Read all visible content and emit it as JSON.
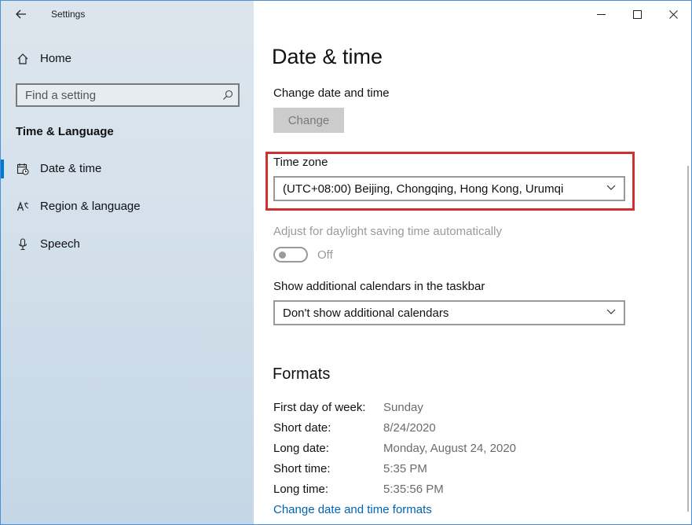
{
  "window": {
    "app_title": "Settings"
  },
  "sidebar": {
    "home_label": "Home",
    "search_placeholder": "Find a setting",
    "section_heading": "Time & Language",
    "items": [
      {
        "label": "Date & time",
        "icon": "calendar-clock-icon",
        "selected": true
      },
      {
        "label": "Region & language",
        "icon": "region-language-icon",
        "selected": false
      },
      {
        "label": "Speech",
        "icon": "microphone-icon",
        "selected": false
      }
    ]
  },
  "main": {
    "page_title": "Date & time",
    "change_date_label": "Change date and time",
    "change_button": "Change",
    "time_zone_label": "Time zone",
    "time_zone_value": "(UTC+08:00) Beijing, Chongqing, Hong Kong, Urumqi",
    "dst_label": "Adjust for daylight saving time automatically",
    "dst_state": "Off",
    "calendars_label": "Show additional calendars in the taskbar",
    "calendars_value": "Don't show additional calendars",
    "formats_title": "Formats",
    "formats": [
      {
        "key": "First day of week:",
        "value": "Sunday"
      },
      {
        "key": "Short date:",
        "value": "8/24/2020"
      },
      {
        "key": "Long date:",
        "value": "Monday, August 24, 2020"
      },
      {
        "key": "Short time:",
        "value": "5:35 PM"
      },
      {
        "key": "Long time:",
        "value": "5:35:56 PM"
      }
    ],
    "formats_link": "Change date and time formats"
  },
  "colors": {
    "accent": "#0078d7",
    "highlight": "#d32f2f",
    "link": "#0063b1"
  }
}
